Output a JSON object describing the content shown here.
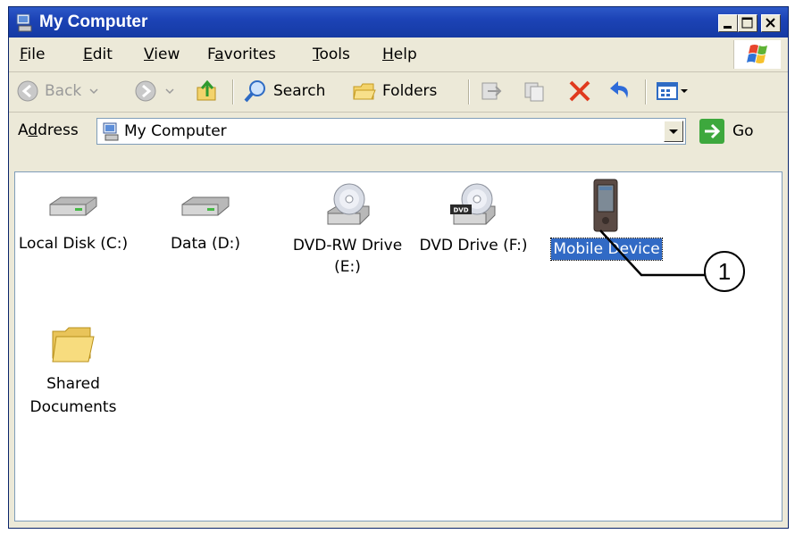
{
  "window": {
    "title": "My Computer"
  },
  "menu": {
    "items": [
      {
        "label": "File",
        "accel": "F",
        "rest": "ile"
      },
      {
        "label": "Edit",
        "accel": "E",
        "rest": "dit"
      },
      {
        "label": "View",
        "accel": "V",
        "rest": "iew"
      },
      {
        "label": "Favorites",
        "pre": "F",
        "accel": "a",
        "rest": "vorites"
      },
      {
        "label": "Tools",
        "accel": "T",
        "rest": "ools"
      },
      {
        "label": "Help",
        "accel": "H",
        "rest": "elp"
      }
    ]
  },
  "toolbar": {
    "back_label": "Back",
    "search_label": "Search",
    "folders_label": "Folders"
  },
  "address": {
    "label_pre": "A",
    "label_accel": "d",
    "label_rest": "dress",
    "value": "My Computer",
    "go_label": "Go"
  },
  "items": [
    {
      "label": "Local Disk (C:)",
      "icon": "hard-disk-icon"
    },
    {
      "label": "Data (D:)",
      "icon": "hard-disk-icon"
    },
    {
      "label": "DVD-RW Drive (E:)",
      "line1": "DVD-RW Drive",
      "line2": "(E:)",
      "icon": "dvd-rw-drive-icon"
    },
    {
      "label": "DVD Drive (F:)",
      "icon": "dvd-drive-icon"
    },
    {
      "label": "Mobile Device",
      "icon": "mobile-device-icon",
      "selected": true
    },
    {
      "label": "Shared Documents",
      "line1": "Shared",
      "line2": "Documents",
      "icon": "folder-icon"
    }
  ],
  "callout": {
    "number": "1"
  }
}
